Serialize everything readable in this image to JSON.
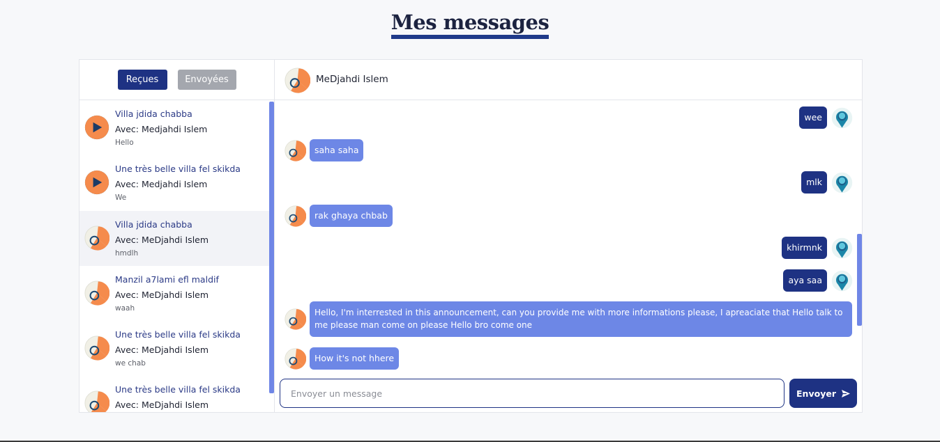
{
  "page": {
    "title": "Mes messages"
  },
  "tabs": {
    "received": "Reçues",
    "sent": "Envoyées"
  },
  "conversations": [
    {
      "title": "Villa jdida chabba",
      "with": "Avec: Medjahdi Islem",
      "last": "Hello",
      "avatar": "play-avatar-icon"
    },
    {
      "title": "Une très belle villa fel skikda",
      "with": "Avec: Medjahdi Islem",
      "last": "We",
      "avatar": "play-avatar-icon"
    },
    {
      "title": "Villa jdida chabba",
      "with": "Avec: MeDjahdi Islem",
      "last": "hmdlh",
      "avatar": "orange-avatar-icon"
    },
    {
      "title": "Manzil a7lami efl maldif",
      "with": "Avec: MeDjahdi Islem",
      "last": "waah",
      "avatar": "orange-avatar-icon"
    },
    {
      "title": "Une très belle villa fel skikda",
      "with": "Avec: MeDjahdi Islem",
      "last": "we chab",
      "avatar": "orange-avatar-icon"
    },
    {
      "title": "Une très belle villa fel skikda",
      "with": "Avec: MeDjahdi Islem",
      "last": "",
      "avatar": "orange-avatar-icon"
    }
  ],
  "chat": {
    "contact_name": "MeDjahdi Islem",
    "messages": [
      {
        "dir": "out",
        "text": "wee"
      },
      {
        "dir": "in",
        "text": "saha saha"
      },
      {
        "dir": "out",
        "text": "mlk"
      },
      {
        "dir": "in",
        "text": "rak ghaya chbab"
      },
      {
        "dir": "out",
        "text": "khirmnk"
      },
      {
        "dir": "out",
        "text": "aya saa"
      },
      {
        "dir": "in",
        "text": "Hello, I'm interrested in this announcement, can you provide me with more informations please, I apreaciate that Hello talk to me please man come on please Hello bro come one"
      },
      {
        "dir": "in",
        "text": "How it's not hhere"
      }
    ]
  },
  "composer": {
    "placeholder": "Envoyer un message",
    "send_label": "Envoyer"
  },
  "colors": {
    "primary": "#1e3283",
    "incoming": "#6d87e6",
    "accent_orange": "#f58b4c",
    "accent_teal": "#1b86a8"
  }
}
